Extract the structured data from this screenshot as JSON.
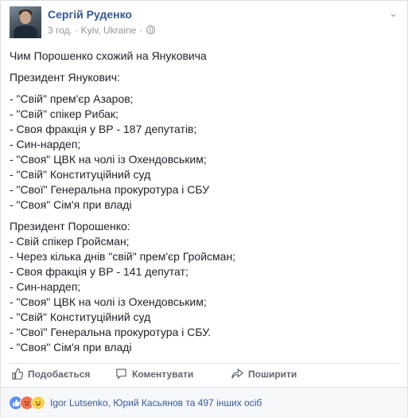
{
  "post": {
    "author": "Сергій Руденко",
    "time": "3 год.",
    "separator": "·",
    "location": "Kyiv, Ukraine",
    "dot2": "·",
    "chevron": "⌄",
    "title": "Чим Порошенко схожий на Януковича",
    "section1_heading": "Президент Янукович:",
    "section1_lines": [
      "- \"Свій\" прем'єр Азаров;",
      "- \"Свій\" спікер Рибак;",
      "- Своя фракція у ВР - 187 депутатів;",
      "- Син-нардеп;",
      "- \"Своя\" ЦВК на чолі із Охендовським;",
      "- \"Свій\" Конституційний суд",
      "- \"Свої\" Генеральна прокуротура і СБУ",
      "- \"Своя\" Сім'я при владі"
    ],
    "section2_heading": "Президент Порошенко:",
    "section2_lines": [
      "- Свій спікер Гройсман;",
      "- Через кілька днів \"свій\" прем'єр Гройсман;",
      "- Своя фракція у ВР - 141 депутат;",
      "- Син-нардеп;",
      "- \"Своя\" ЦВК на чолі із Охендовським;",
      "- \"Свій\" Конституційний суд",
      "- \"Свої\" Генеральна прокуротура і СБУ.",
      "- \"Своя\" Сім'я при владі"
    ]
  },
  "actions": {
    "like": "Подобається",
    "comment": "Коментувати",
    "share": "Поширити"
  },
  "reactions": {
    "text": "Igor Lutsenko, Юрий Касьянов та 497 інших осіб"
  },
  "icons": {
    "avatar": "profile-photo",
    "globe": "globe-icon",
    "like": "thumbs-up-icon",
    "comment": "comment-bubble-icon",
    "share": "share-arrow-icon"
  },
  "colors": {
    "link": "#365899",
    "meta": "#90949c",
    "action": "#606770",
    "like_reaction": "#5890ff",
    "angry_reaction": "#f7714b",
    "haha_reaction": "#f7d14b"
  }
}
